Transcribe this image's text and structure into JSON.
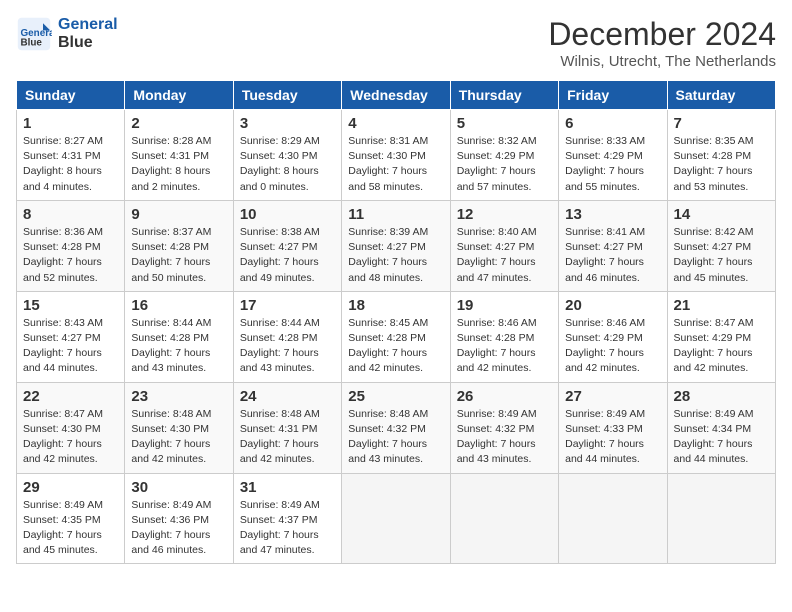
{
  "header": {
    "logo_line1": "General",
    "logo_line2": "Blue",
    "title": "December 2024",
    "subtitle": "Wilnis, Utrecht, The Netherlands"
  },
  "days_of_week": [
    "Sunday",
    "Monday",
    "Tuesday",
    "Wednesday",
    "Thursday",
    "Friday",
    "Saturday"
  ],
  "weeks": [
    [
      {
        "num": "1",
        "sunrise": "8:27 AM",
        "sunset": "4:31 PM",
        "daylight": "8 hours and 4 minutes."
      },
      {
        "num": "2",
        "sunrise": "8:28 AM",
        "sunset": "4:31 PM",
        "daylight": "8 hours and 2 minutes."
      },
      {
        "num": "3",
        "sunrise": "8:29 AM",
        "sunset": "4:30 PM",
        "daylight": "8 hours and 0 minutes."
      },
      {
        "num": "4",
        "sunrise": "8:31 AM",
        "sunset": "4:30 PM",
        "daylight": "7 hours and 58 minutes."
      },
      {
        "num": "5",
        "sunrise": "8:32 AM",
        "sunset": "4:29 PM",
        "daylight": "7 hours and 57 minutes."
      },
      {
        "num": "6",
        "sunrise": "8:33 AM",
        "sunset": "4:29 PM",
        "daylight": "7 hours and 55 minutes."
      },
      {
        "num": "7",
        "sunrise": "8:35 AM",
        "sunset": "4:28 PM",
        "daylight": "7 hours and 53 minutes."
      }
    ],
    [
      {
        "num": "8",
        "sunrise": "8:36 AM",
        "sunset": "4:28 PM",
        "daylight": "7 hours and 52 minutes."
      },
      {
        "num": "9",
        "sunrise": "8:37 AM",
        "sunset": "4:28 PM",
        "daylight": "7 hours and 50 minutes."
      },
      {
        "num": "10",
        "sunrise": "8:38 AM",
        "sunset": "4:27 PM",
        "daylight": "7 hours and 49 minutes."
      },
      {
        "num": "11",
        "sunrise": "8:39 AM",
        "sunset": "4:27 PM",
        "daylight": "7 hours and 48 minutes."
      },
      {
        "num": "12",
        "sunrise": "8:40 AM",
        "sunset": "4:27 PM",
        "daylight": "7 hours and 47 minutes."
      },
      {
        "num": "13",
        "sunrise": "8:41 AM",
        "sunset": "4:27 PM",
        "daylight": "7 hours and 46 minutes."
      },
      {
        "num": "14",
        "sunrise": "8:42 AM",
        "sunset": "4:27 PM",
        "daylight": "7 hours and 45 minutes."
      }
    ],
    [
      {
        "num": "15",
        "sunrise": "8:43 AM",
        "sunset": "4:27 PM",
        "daylight": "7 hours and 44 minutes."
      },
      {
        "num": "16",
        "sunrise": "8:44 AM",
        "sunset": "4:28 PM",
        "daylight": "7 hours and 43 minutes."
      },
      {
        "num": "17",
        "sunrise": "8:44 AM",
        "sunset": "4:28 PM",
        "daylight": "7 hours and 43 minutes."
      },
      {
        "num": "18",
        "sunrise": "8:45 AM",
        "sunset": "4:28 PM",
        "daylight": "7 hours and 42 minutes."
      },
      {
        "num": "19",
        "sunrise": "8:46 AM",
        "sunset": "4:28 PM",
        "daylight": "7 hours and 42 minutes."
      },
      {
        "num": "20",
        "sunrise": "8:46 AM",
        "sunset": "4:29 PM",
        "daylight": "7 hours and 42 minutes."
      },
      {
        "num": "21",
        "sunrise": "8:47 AM",
        "sunset": "4:29 PM",
        "daylight": "7 hours and 42 minutes."
      }
    ],
    [
      {
        "num": "22",
        "sunrise": "8:47 AM",
        "sunset": "4:30 PM",
        "daylight": "7 hours and 42 minutes."
      },
      {
        "num": "23",
        "sunrise": "8:48 AM",
        "sunset": "4:30 PM",
        "daylight": "7 hours and 42 minutes."
      },
      {
        "num": "24",
        "sunrise": "8:48 AM",
        "sunset": "4:31 PM",
        "daylight": "7 hours and 42 minutes."
      },
      {
        "num": "25",
        "sunrise": "8:48 AM",
        "sunset": "4:32 PM",
        "daylight": "7 hours and 43 minutes."
      },
      {
        "num": "26",
        "sunrise": "8:49 AM",
        "sunset": "4:32 PM",
        "daylight": "7 hours and 43 minutes."
      },
      {
        "num": "27",
        "sunrise": "8:49 AM",
        "sunset": "4:33 PM",
        "daylight": "7 hours and 44 minutes."
      },
      {
        "num": "28",
        "sunrise": "8:49 AM",
        "sunset": "4:34 PM",
        "daylight": "7 hours and 44 minutes."
      }
    ],
    [
      {
        "num": "29",
        "sunrise": "8:49 AM",
        "sunset": "4:35 PM",
        "daylight": "7 hours and 45 minutes."
      },
      {
        "num": "30",
        "sunrise": "8:49 AM",
        "sunset": "4:36 PM",
        "daylight": "7 hours and 46 minutes."
      },
      {
        "num": "31",
        "sunrise": "8:49 AM",
        "sunset": "4:37 PM",
        "daylight": "7 hours and 47 minutes."
      },
      null,
      null,
      null,
      null
    ]
  ]
}
